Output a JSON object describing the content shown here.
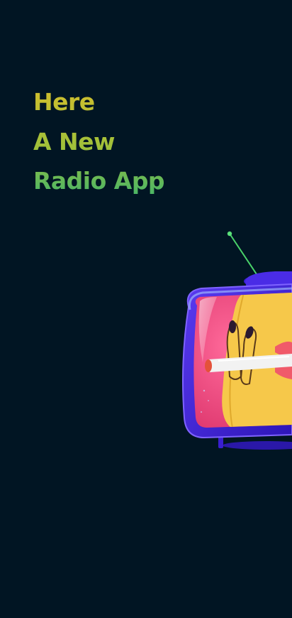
{
  "screen": {
    "background_color": "#011523"
  },
  "headline": {
    "lines": [
      "Here",
      "A New",
      "Radio App"
    ],
    "gradient_top": "#d6be2c",
    "gradient_bottom": "#40b46b"
  },
  "illustration": {
    "icon": "retro-tv-with-cartoon-smoking-mouth",
    "tv_body_color": "#3f1fd6",
    "screen_color": "#f0457a"
  }
}
